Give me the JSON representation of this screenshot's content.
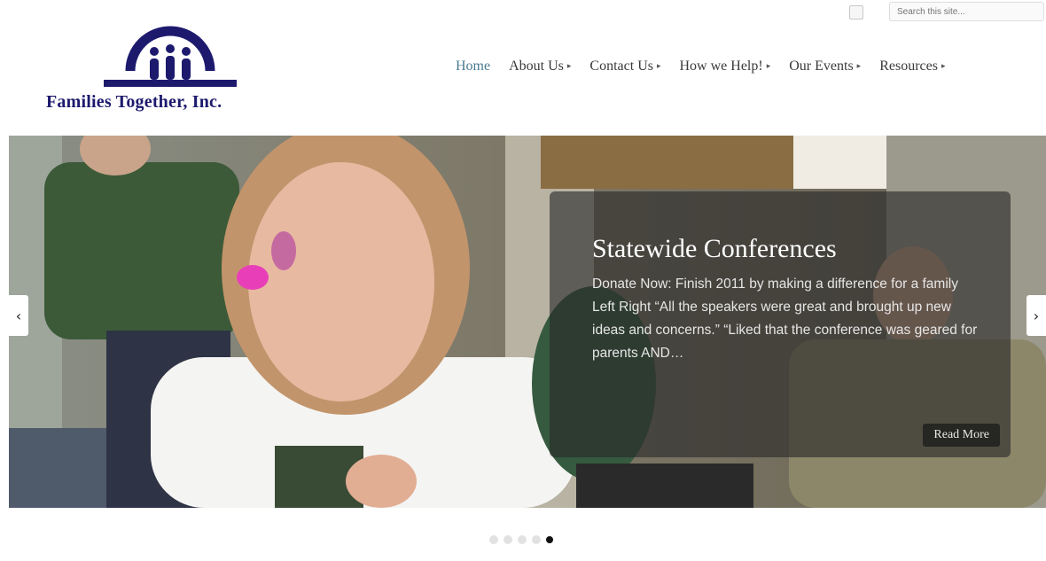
{
  "header": {
    "search": {
      "placeholder": "Search this site..."
    },
    "logo": {
      "text": "Families Together, Inc.",
      "icon": "families-together-logo"
    }
  },
  "nav": {
    "items": [
      {
        "label": "Home",
        "active": true,
        "has_dropdown": false
      },
      {
        "label": "About Us",
        "has_dropdown": true
      },
      {
        "label": "Contact Us",
        "has_dropdown": true
      },
      {
        "label": "How we Help!",
        "has_dropdown": true
      },
      {
        "label": "Our Events",
        "has_dropdown": true
      },
      {
        "label": "Resources",
        "has_dropdown": true
      }
    ],
    "caret": "▸"
  },
  "slider": {
    "title": "Statewide Conferences",
    "excerpt": "Donate Now: Finish 2011 by making a difference for a family Left Right “All the speakers were great and brought up new ideas and concerns.” “Liked that the conference was geared for parents AND…",
    "read_more": "Read More",
    "prev_icon": "chevron-left-icon",
    "next_icon": "chevron-right-icon",
    "slide_count": 5,
    "active_slide": 5
  },
  "colors": {
    "logo_navy": "#1d1a6e",
    "nav_active": "#4a7b92",
    "caption_bg": "rgba(40,40,40,0.62)"
  }
}
